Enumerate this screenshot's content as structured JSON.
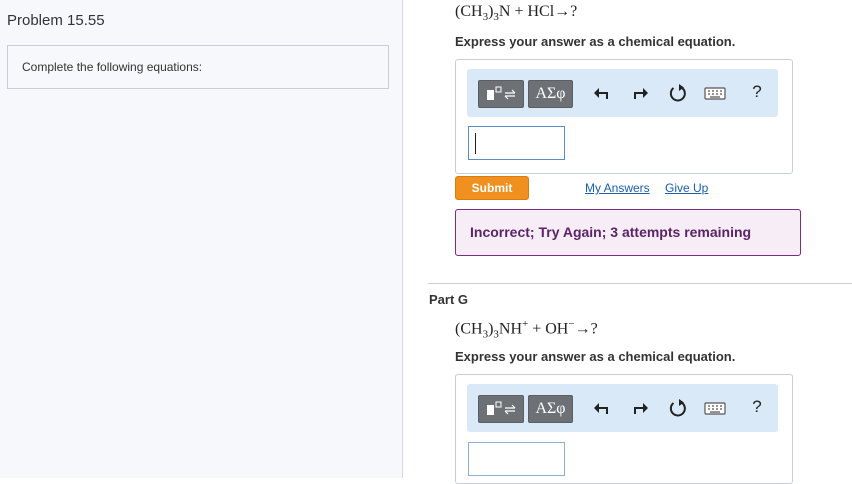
{
  "sidebar": {
    "problem_title": "Problem 15.55",
    "instruction": "Complete the following equations:"
  },
  "part_f": {
    "equation": {
      "group": "(CH",
      "sub1": "3",
      "close": ")",
      "sub2": "3",
      "rest": "N + HCl→?"
    },
    "prompt": "Express your answer as a chemical equation.",
    "toolbar": {
      "greek_label": "ΑΣφ",
      "help_label": "?"
    },
    "submit_label": "Submit",
    "my_answers_label": "My Answers",
    "give_up_label": "Give Up",
    "feedback": "Incorrect; Try Again; 3 attempts remaining"
  },
  "part_g": {
    "title": "Part G",
    "equation": {
      "group": "(CH",
      "sub1": "3",
      "close": ")",
      "sub2": "3",
      "mid": "NH",
      "sup1": "+",
      "plus": " + OH",
      "sup2": "−",
      "rest": "→?"
    },
    "prompt": "Express your answer as a chemical equation.",
    "toolbar": {
      "greek_label": "ΑΣφ",
      "help_label": "?"
    }
  },
  "icons": {
    "templates": "templates-icon",
    "undo": "undo-icon",
    "redo": "redo-icon",
    "reset": "reset-icon",
    "keyboard": "keyboard-icon",
    "help": "help-icon"
  },
  "colors": {
    "submit": "#f0901e",
    "feedback_border": "#7b2d83",
    "link": "#1a5fad",
    "toolbar_bg": "#d9e9f7"
  }
}
